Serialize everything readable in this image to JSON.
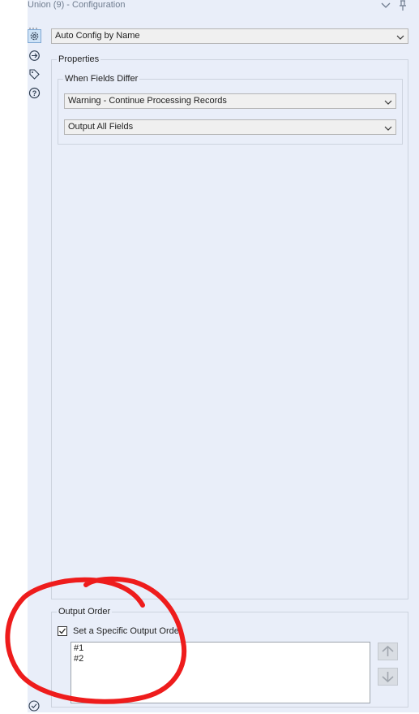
{
  "window": {
    "title": "Union (9) - Configuration"
  },
  "toolbar_icons": [
    "gear-icon",
    "connection-icon",
    "tag-icon",
    "help-icon"
  ],
  "mode_select": {
    "value": "Auto Config by Name"
  },
  "properties": {
    "legend": "Properties",
    "when_fields_differ": {
      "legend": "When Fields Differ",
      "action_select": "Warning - Continue Processing Records",
      "fields_select": "Output All Fields"
    }
  },
  "output_order": {
    "legend": "Output Order",
    "checkbox_label": "Set a Specific Output Order",
    "checked": true,
    "items": [
      "#1",
      "#2"
    ]
  },
  "annotation": {
    "color": "#ee1c1c",
    "shape": "hand-drawn-circle"
  }
}
